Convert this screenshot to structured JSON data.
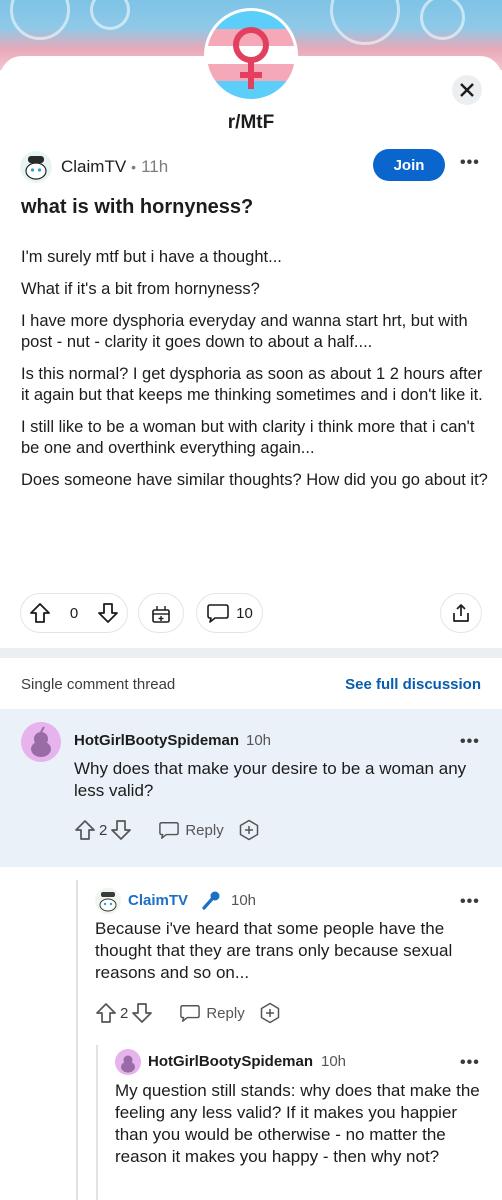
{
  "subreddit": {
    "name": "r/MtF"
  },
  "post": {
    "author": "ClaimTV",
    "separator": "•",
    "age": "11h",
    "join_label": "Join",
    "more_label": "•••",
    "title": "what is with hornyness?",
    "paragraphs": [
      "I'm surely mtf but i have a thought...",
      "What if it's a bit from hornyness?",
      "I have more dysphoria everyday and wanna start hrt, but with post - nut - clarity it goes down to about a half....",
      "Is this normal? I get dysphoria as soon as about 1 2 hours after it again but that keeps me thinking sometimes and i don't like it.",
      "I still like to be a woman but with clarity i think more that i can't be one and overthink everything again...",
      "Does someone have similar thoughts? How did you go about it?"
    ],
    "vote_count": "0",
    "comment_count": "10"
  },
  "thread": {
    "label": "Single comment thread",
    "see_full": "See full discussion"
  },
  "comments": [
    {
      "user": "HotGirlBootySpideman",
      "age": "10h",
      "text": "Why does that make your desire to be a woman any less valid?",
      "votes": "2",
      "reply_label": "Reply",
      "more_label": "•••"
    },
    {
      "user": "ClaimTV",
      "age": "10h",
      "text": "Because i've heard that some people have the thought that they are trans only because sexual reasons and so on...",
      "votes": "2",
      "reply_label": "Reply",
      "more_label": "•••"
    },
    {
      "user": "HotGirlBootySpideman",
      "age": "10h",
      "text": "My question still stands: why does that make the feeling any less valid? If it makes you happier than you would be otherwise - no matter the reason it makes you happy - then why not?",
      "more_label": "•••"
    }
  ],
  "colors": {
    "join_blue": "#0a66cc",
    "link_blue": "#0a5cad",
    "op_blue": "#1b6fc6",
    "highlight": "#eaf1f8",
    "trans_blue": "#5bcefa",
    "trans_pink": "#f5a9b8"
  },
  "icons": [
    "close-icon",
    "upvote-icon",
    "downvote-icon",
    "award-icon",
    "comment-icon",
    "share-icon",
    "more-icon",
    "microphone-icon",
    "female-symbol-icon",
    "snoo-avatar-icon"
  ]
}
